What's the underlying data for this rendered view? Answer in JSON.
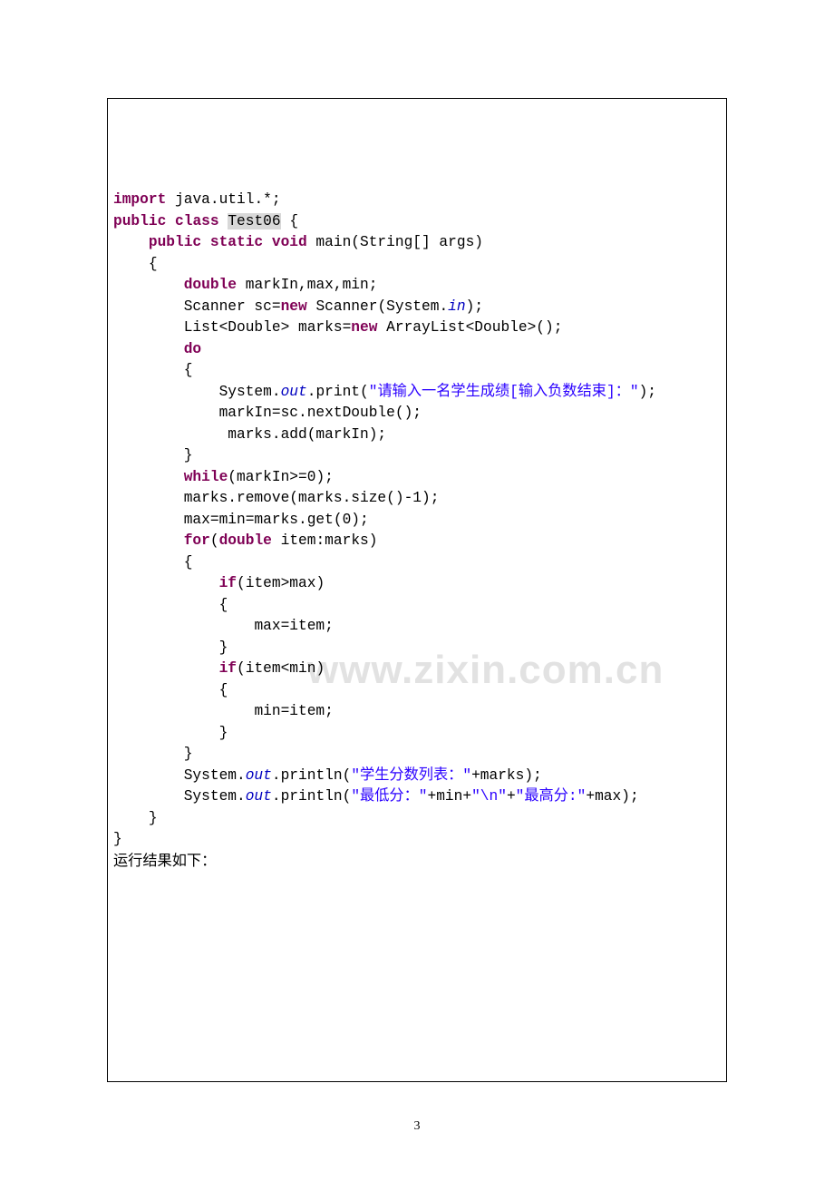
{
  "page_number": "3",
  "watermark": "www.zixin.com.cn",
  "footer_label": "运行结果如下：",
  "code": {
    "import_kw": "import",
    "import_rest": " java.util.*;",
    "public_kw": "public",
    "class_kw": "class",
    "class_name": "Test06",
    "open_brace": " {",
    "main_mods": "public static void",
    "main_sig": " main(String[] args)",
    "double_kw": "double",
    "double_vars": " markIn,max,min;",
    "scanner_line_a": "Scanner sc=",
    "new_kw": "new",
    "scanner_line_b": " Scanner(System.",
    "in_fld": "in",
    "scanner_line_c": ");",
    "list_line_a": "List<Double> marks=",
    "list_line_b": " ArrayList<Double>();",
    "do_kw": "do",
    "sysout_a": "System.",
    "out_fld": "out",
    "print_a": ".print(",
    "str_prompt": "\"请输入一名学生成绩[输入负数结束]：\"",
    "print_close": ");",
    "markin_line": "markIn=sc.nextDouble();",
    "marks_add": " marks.add(markIn);",
    "while_kw": "while",
    "while_cond": "(markIn>=0);",
    "remove_line": "marks.remove(marks.size()-1);",
    "maxmin_line": "max=min=marks.get(0);",
    "for_kw": "for",
    "for_cond_a": "(",
    "for_cond_b": " item:marks)",
    "if_kw": "if",
    "if_max": "(item>max)",
    "max_assign": "max=item;",
    "if_min": "(item<min)",
    "min_assign": "min=item;",
    "println_a": ".println(",
    "str_list": "\"学生分数列表：\"",
    "plus_marks": "+marks);",
    "str_min": "\"最低分：\"",
    "plus_min": "+min+",
    "str_nl": "\"\\n\"",
    "plus_mid": "+",
    "str_max": "\"最高分:\"",
    "plus_max": "+max);"
  }
}
